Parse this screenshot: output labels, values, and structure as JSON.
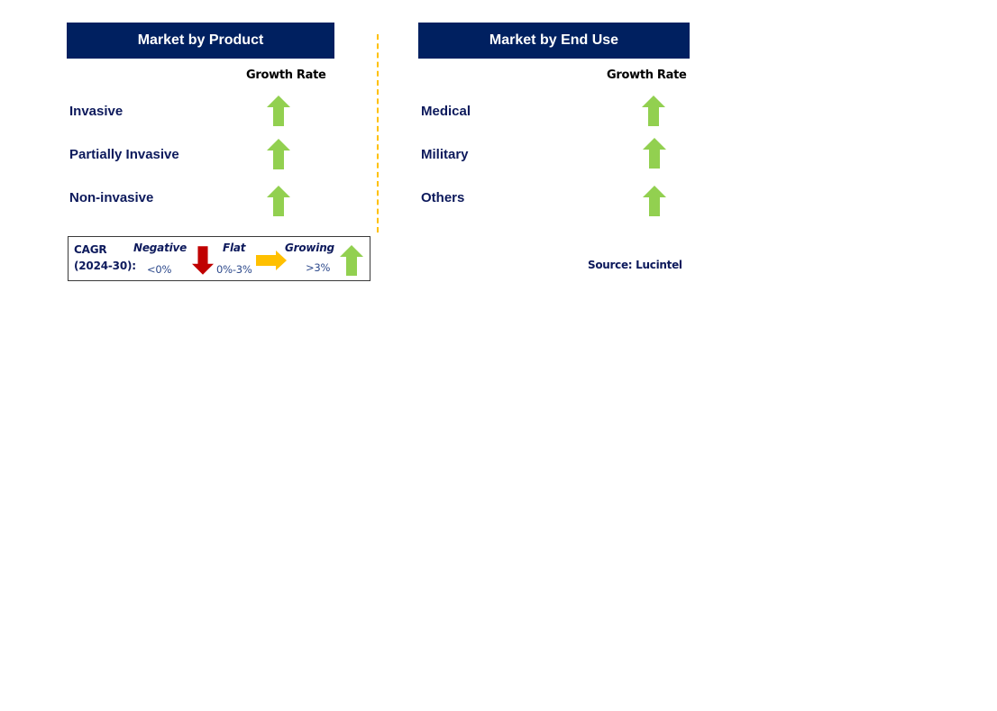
{
  "colors": {
    "header_bg": "#002060",
    "growing": "#92d050",
    "negative": "#c00000",
    "flat": "#ffc000",
    "divider": "#ffc000"
  },
  "panels": [
    {
      "title": "Market by Product",
      "column_header": "Growth Rate",
      "rows": [
        {
          "label": "Invasive",
          "trend": "growing",
          "icon": "green-up-arrow-icon"
        },
        {
          "label": "Partially Invasive",
          "trend": "growing",
          "icon": "green-up-arrow-icon"
        },
        {
          "label": "Non-invasive",
          "trend": "growing",
          "icon": "green-up-arrow-icon"
        }
      ]
    },
    {
      "title": "Market by End Use",
      "column_header": "Growth Rate",
      "rows": [
        {
          "label": "Medical",
          "trend": "growing",
          "icon": "green-up-arrow-icon"
        },
        {
          "label": "Military",
          "trend": "growing",
          "icon": "green-up-arrow-icon"
        },
        {
          "label": "Others",
          "trend": "growing",
          "icon": "green-up-arrow-icon"
        }
      ]
    }
  ],
  "legend": {
    "title_line1": "CAGR",
    "title_line2": "(2024-30):",
    "items": [
      {
        "category": "Negative",
        "range": "<0%",
        "icon": "red-down-arrow-icon"
      },
      {
        "category": "Flat",
        "range": "0%-3%",
        "icon": "yellow-right-arrow-icon"
      },
      {
        "category": "Growing",
        "range": ">3%",
        "icon": "green-up-arrow-icon"
      }
    ]
  },
  "source": "Source: Lucintel"
}
